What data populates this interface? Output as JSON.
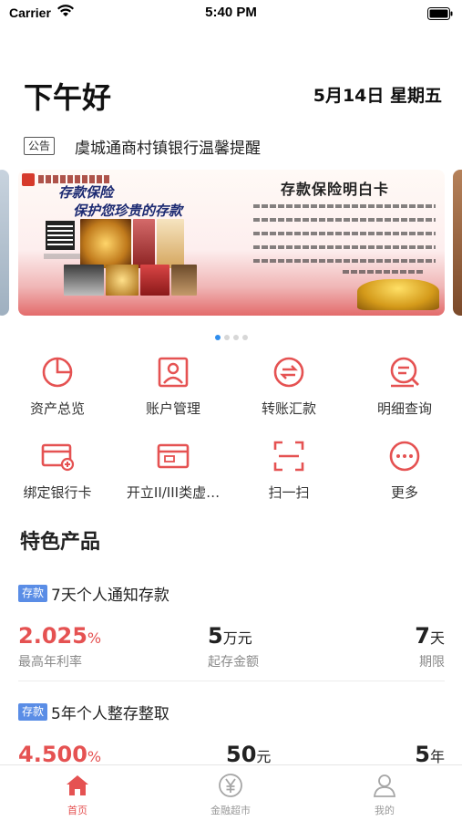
{
  "status_bar": {
    "carrier": "Carrier",
    "time": "5:40 PM"
  },
  "header": {
    "greeting": "下午好",
    "date": "5月14日 星期五"
  },
  "notice": {
    "badge": "公告",
    "text": "虞城通商村镇银行温馨提醒"
  },
  "banner": {
    "title_left_1": "存款保险",
    "title_left_2": "保护您珍贵的存款",
    "title_right": "存款保险明白卡",
    "page_count": 4,
    "active_page": 0
  },
  "menu": {
    "items": [
      {
        "label": "资产总览",
        "icon": "pie-chart-icon"
      },
      {
        "label": "账户管理",
        "icon": "account-icon"
      },
      {
        "label": "转账汇款",
        "icon": "transfer-icon"
      },
      {
        "label": "明细查询",
        "icon": "search-detail-icon"
      },
      {
        "label": "绑定银行卡",
        "icon": "bind-card-icon"
      },
      {
        "label": "开立II/III类虚…",
        "icon": "open-account-card-icon"
      },
      {
        "label": "扫一扫",
        "icon": "scan-icon"
      },
      {
        "label": "更多",
        "icon": "more-icon"
      }
    ]
  },
  "featured": {
    "title": "特色产品",
    "products": [
      {
        "tag": "存款",
        "name": "7天个人通知存款",
        "rate_value": "2.025",
        "rate_unit": "%",
        "rate_label": "最高年利率",
        "min_value": "5",
        "min_unit": "万元",
        "min_label": "起存金额",
        "term_value": "7",
        "term_unit": "天",
        "term_label": "期限"
      },
      {
        "tag": "存款",
        "name": "5年个人整存整取",
        "rate_value": "4.500",
        "rate_unit": "%",
        "rate_label": "",
        "min_value": "50",
        "min_unit": "元",
        "min_label": "",
        "term_value": "5",
        "term_unit": "年",
        "term_label": ""
      }
    ]
  },
  "tabbar": {
    "items": [
      {
        "label": "首页",
        "icon": "home-icon",
        "active": true
      },
      {
        "label": "金融超市",
        "icon": "yuan-icon",
        "active": false
      },
      {
        "label": "我的",
        "icon": "user-icon",
        "active": false
      }
    ]
  },
  "colors": {
    "accent": "#e55252",
    "tag_blue": "#5a8de6",
    "dot_active": "#2f8ded"
  }
}
